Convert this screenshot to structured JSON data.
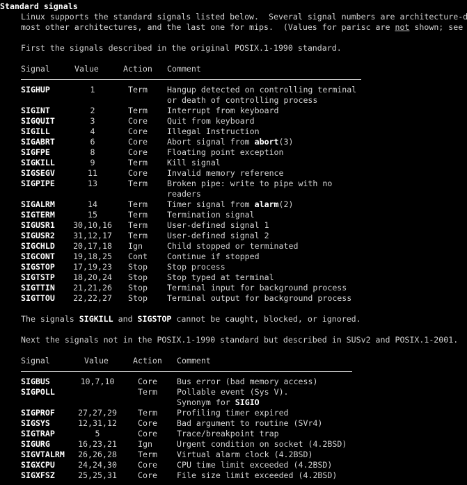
{
  "section_title": "Standard signals",
  "intro": {
    "line1": "Linux supports the standard signals listed below.  Several signal numbers are architecture-d",
    "line2_pre": "most other architectures, and the last one for mips.  (Values for parisc are ",
    "line2_underlined": "not",
    "line2_post": " shown; see",
    "posix_intro": "First the signals described in the original POSIX.1-1990 standard."
  },
  "headers": {
    "signal": "Signal",
    "value": "Value",
    "action": "Action",
    "comment": "Comment"
  },
  "table1": [
    {
      "signal": "SIGHUP",
      "value": "1",
      "action": "Term",
      "comment": [
        [
          {
            "t": "Hangup detected on controlling terminal"
          }
        ],
        [
          {
            "t": "or death of controlling process"
          }
        ]
      ]
    },
    {
      "signal": "SIGINT",
      "value": "2",
      "action": "Term",
      "comment": [
        [
          {
            "t": "Interrupt from keyboard"
          }
        ]
      ]
    },
    {
      "signal": "SIGQUIT",
      "value": "3",
      "action": "Core",
      "comment": [
        [
          {
            "t": "Quit from keyboard"
          }
        ]
      ]
    },
    {
      "signal": "SIGILL",
      "value": "4",
      "action": "Core",
      "comment": [
        [
          {
            "t": "Illegal Instruction"
          }
        ]
      ]
    },
    {
      "signal": "SIGABRT",
      "value": "6",
      "action": "Core",
      "comment": [
        [
          {
            "t": "Abort signal from "
          },
          {
            "t": "abort",
            "b": true
          },
          {
            "t": "(3)"
          }
        ]
      ]
    },
    {
      "signal": "SIGFPE",
      "value": "8",
      "action": "Core",
      "comment": [
        [
          {
            "t": "Floating point exception"
          }
        ]
      ]
    },
    {
      "signal": "SIGKILL",
      "value": "9",
      "action": "Term",
      "comment": [
        [
          {
            "t": "Kill signal"
          }
        ]
      ]
    },
    {
      "signal": "SIGSEGV",
      "value": "11",
      "action": "Core",
      "comment": [
        [
          {
            "t": "Invalid memory reference"
          }
        ]
      ]
    },
    {
      "signal": "SIGPIPE",
      "value": "13",
      "action": "Term",
      "comment": [
        [
          {
            "t": "Broken pipe: write to pipe with no"
          }
        ],
        [
          {
            "t": "readers"
          }
        ]
      ]
    },
    {
      "signal": "SIGALRM",
      "value": "14",
      "action": "Term",
      "comment": [
        [
          {
            "t": "Timer signal from "
          },
          {
            "t": "alarm",
            "b": true
          },
          {
            "t": "(2)"
          }
        ]
      ]
    },
    {
      "signal": "SIGTERM",
      "value": "15",
      "action": "Term",
      "comment": [
        [
          {
            "t": "Termination signal"
          }
        ]
      ]
    },
    {
      "signal": "SIGUSR1",
      "value": "30,10,16",
      "action": "Term",
      "comment": [
        [
          {
            "t": "User-defined signal 1"
          }
        ]
      ]
    },
    {
      "signal": "SIGUSR2",
      "value": "31,12,17",
      "action": "Term",
      "comment": [
        [
          {
            "t": "User-defined signal 2"
          }
        ]
      ]
    },
    {
      "signal": "SIGCHLD",
      "value": "20,17,18",
      "action": "Ign",
      "comment": [
        [
          {
            "t": "Child stopped or terminated"
          }
        ]
      ]
    },
    {
      "signal": "SIGCONT",
      "value": "19,18,25",
      "action": "Cont",
      "comment": [
        [
          {
            "t": "Continue if stopped"
          }
        ]
      ]
    },
    {
      "signal": "SIGSTOP",
      "value": "17,19,23",
      "action": "Stop",
      "comment": [
        [
          {
            "t": "Stop process"
          }
        ]
      ]
    },
    {
      "signal": "SIGTSTP",
      "value": "18,20,24",
      "action": "Stop",
      "comment": [
        [
          {
            "t": "Stop typed at terminal"
          }
        ]
      ]
    },
    {
      "signal": "SIGTTIN",
      "value": "21,21,26",
      "action": "Stop",
      "comment": [
        [
          {
            "t": "Terminal input for background process"
          }
        ]
      ]
    },
    {
      "signal": "SIGTTOU",
      "value": "22,22,27",
      "action": "Stop",
      "comment": [
        [
          {
            "t": "Terminal output for background process"
          }
        ]
      ]
    }
  ],
  "note": {
    "pre": "The signals ",
    "sig1": "SIGKILL",
    "mid": " and ",
    "sig2": "SIGSTOP",
    "post": " cannot be caught, blocked, or ignored."
  },
  "susv2_intro": "Next the signals not in the POSIX.1-1990 standard but described in SUSv2 and POSIX.1-2001.",
  "table2": [
    {
      "signal": "SIGBUS",
      "value": "10,7,10",
      "action": "Core",
      "comment": [
        [
          {
            "t": "Bus error (bad memory access)"
          }
        ]
      ]
    },
    {
      "signal": "SIGPOLL",
      "value": "",
      "action": "Term",
      "comment": [
        [
          {
            "t": "Pollable event (Sys V)."
          }
        ],
        [
          {
            "t": "Synonym for "
          },
          {
            "t": "SIGIO",
            "b": true
          }
        ]
      ]
    },
    {
      "signal": "SIGPROF",
      "value": "27,27,29",
      "action": "Term",
      "comment": [
        [
          {
            "t": "Profiling timer expired"
          }
        ]
      ]
    },
    {
      "signal": "SIGSYS",
      "value": "12,31,12",
      "action": "Core",
      "comment": [
        [
          {
            "t": "Bad argument to routine (SVr4)"
          }
        ]
      ]
    },
    {
      "signal": "SIGTRAP",
      "value": "5",
      "action": "Core",
      "comment": [
        [
          {
            "t": "Trace/breakpoint trap"
          }
        ]
      ]
    },
    {
      "signal": "SIGURG",
      "value": "16,23,21",
      "action": "Ign",
      "comment": [
        [
          {
            "t": "Urgent condition on socket (4.2BSD)"
          }
        ]
      ]
    },
    {
      "signal": "SIGVTALRM",
      "value": "26,26,28",
      "action": "Term",
      "comment": [
        [
          {
            "t": "Virtual alarm clock (4.2BSD)"
          }
        ]
      ]
    },
    {
      "signal": "SIGXCPU",
      "value": "24,24,30",
      "action": "Core",
      "comment": [
        [
          {
            "t": "CPU time limit exceeded (4.2BSD)"
          }
        ]
      ]
    },
    {
      "signal": "SIGXFSZ",
      "value": "25,25,31",
      "action": "Core",
      "comment": [
        [
          {
            "t": "File size limit exceeded (4.2BSD)"
          }
        ]
      ]
    }
  ]
}
